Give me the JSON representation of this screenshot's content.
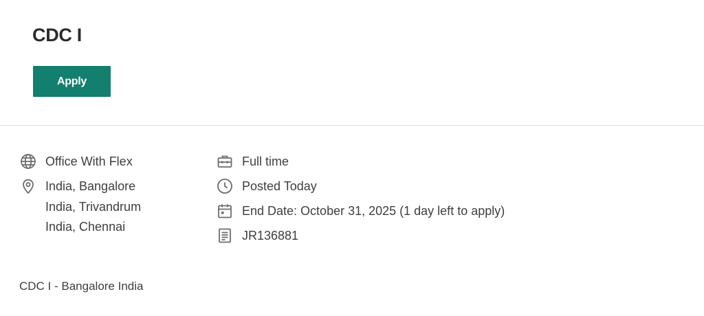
{
  "job": {
    "title": "CDC I",
    "apply_label": "Apply"
  },
  "meta_left": {
    "work_mode": {
      "icon": "globe-icon",
      "text": "Office With Flex"
    },
    "locations": {
      "icon": "location-pin-icon",
      "items": [
        "India, Bangalore",
        "India, Trivandrum",
        "India, Chennai"
      ]
    }
  },
  "meta_right": {
    "employment_type": {
      "icon": "briefcase-icon",
      "text": "Full time"
    },
    "posted": {
      "icon": "clock-icon",
      "text": "Posted Today"
    },
    "end_date": {
      "icon": "calendar-icon",
      "text": "End Date: October 31, 2025 (1 day left to apply)"
    },
    "req_id": {
      "icon": "document-icon",
      "text": "JR136881"
    }
  },
  "summary": "CDC I - Bangalore India",
  "colors": {
    "accent": "#137f6e",
    "text": "#3e3e3e",
    "icon": "#6b6b6b",
    "divider": "#dcdcdc"
  }
}
